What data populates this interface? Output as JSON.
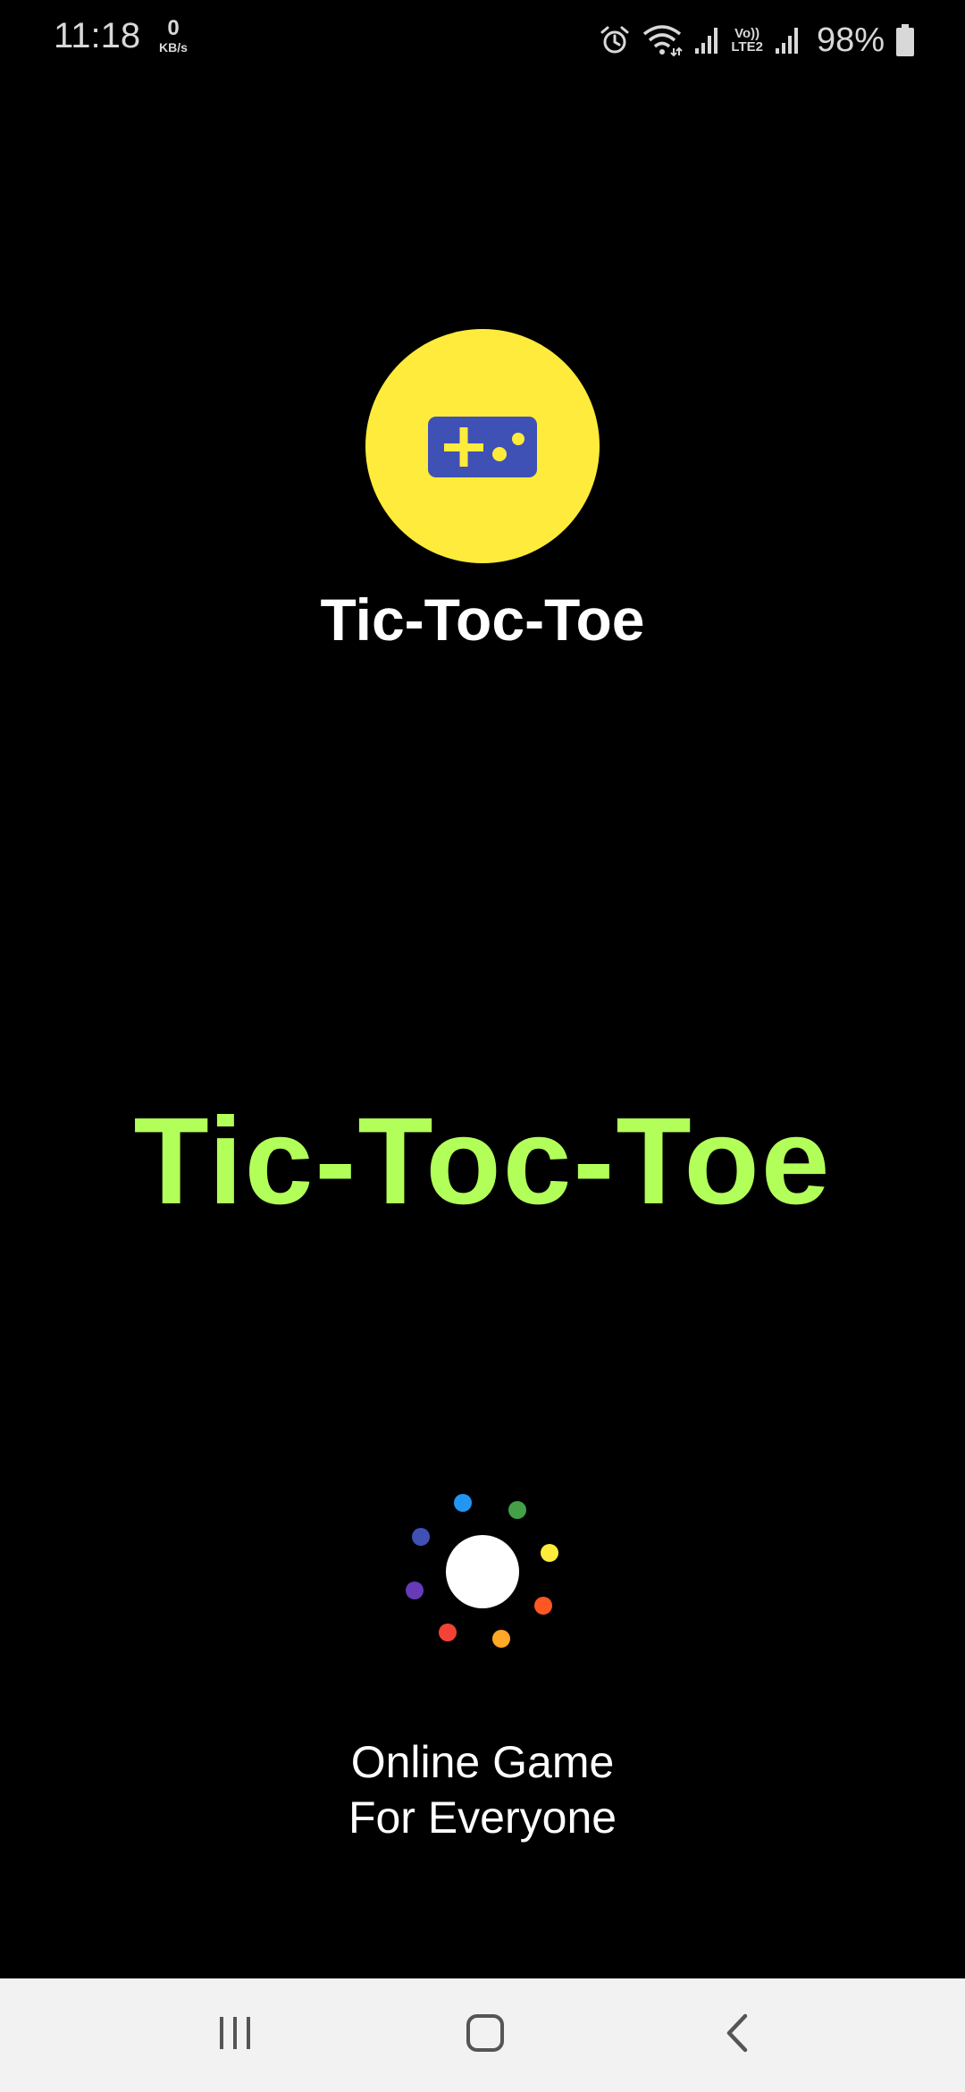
{
  "status_bar": {
    "time": "11:18",
    "net_speed_value": "0",
    "net_speed_unit": "KB/s",
    "volte_line1": "Vo))",
    "volte_line2": "LTE2",
    "battery_percent": "98%",
    "icons": [
      "alarm-icon",
      "wifi-icon",
      "signal-icon",
      "signal-icon",
      "battery-icon"
    ]
  },
  "logo": {
    "icon": "gamepad-icon",
    "circle_color": "#ffeb3b",
    "icon_color": "#3f51b5",
    "title": "Tic-Toc-Toe"
  },
  "splash": {
    "title": "Tic-Toc-Toe",
    "title_color": "#b2ff59",
    "tagline_line1": "Online Game",
    "tagline_line2": "For Everyone"
  },
  "loader": {
    "dot_colors": [
      "#2196f3",
      "#43a047",
      "#ffeb3b",
      "#ff5722",
      "#ffa726",
      "#f44336",
      "#673ab7",
      "#3f51b5"
    ]
  },
  "nav_bar": {
    "buttons": [
      "recents-icon",
      "home-icon",
      "back-icon"
    ]
  }
}
